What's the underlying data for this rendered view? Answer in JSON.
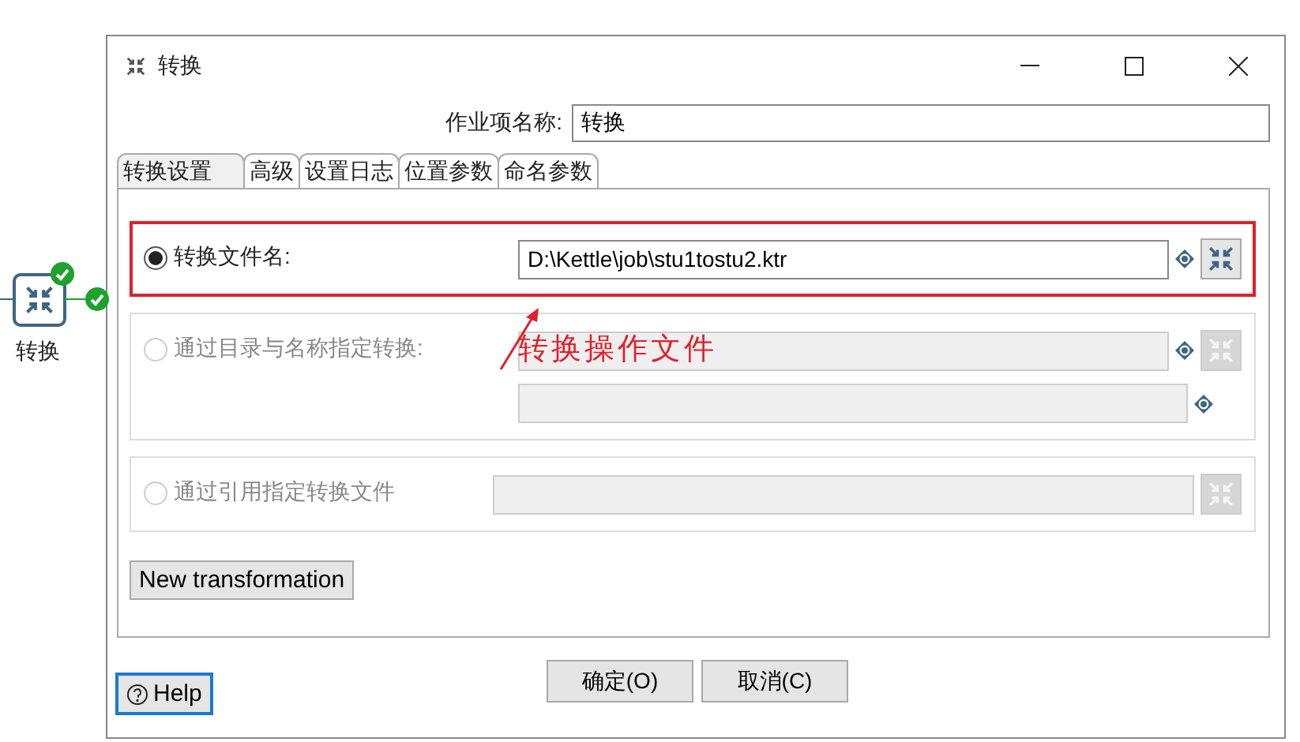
{
  "canvas_node": {
    "label": "转换"
  },
  "window": {
    "title": "转换"
  },
  "job_name": {
    "label": "作业项名称:",
    "value": "转换"
  },
  "tabs": [
    {
      "label": "转换设置",
      "selected": true
    },
    {
      "label": "高级",
      "selected": false
    },
    {
      "label": "设置日志",
      "selected": false
    },
    {
      "label": "位置参数",
      "selected": false
    },
    {
      "label": "命名参数",
      "selected": false
    }
  ],
  "options": [
    {
      "label": "转换文件名:",
      "selected": true,
      "disabled": false,
      "highlighted": true,
      "fields": [
        {
          "value": "D:\\Kettle\\job\\stu1tostu2.ktr",
          "variable": true,
          "browse": true
        }
      ]
    },
    {
      "label": "通过目录与名称指定转换:",
      "selected": false,
      "disabled": true,
      "highlighted": false,
      "fields": [
        {
          "variable": true,
          "browse": true
        },
        {
          "variable": true,
          "browse": false
        }
      ]
    },
    {
      "label": "通过引用指定转换文件",
      "selected": false,
      "disabled": true,
      "highlighted": false,
      "fields": [
        {
          "variable": false,
          "browse": true
        }
      ]
    }
  ],
  "annotation": {
    "text": "转换操作文件"
  },
  "new_transformation_button": "New transformation",
  "buttons": [
    {
      "label": "确定(O)"
    },
    {
      "label": "取消(C)"
    }
  ],
  "help_button": "Help"
}
